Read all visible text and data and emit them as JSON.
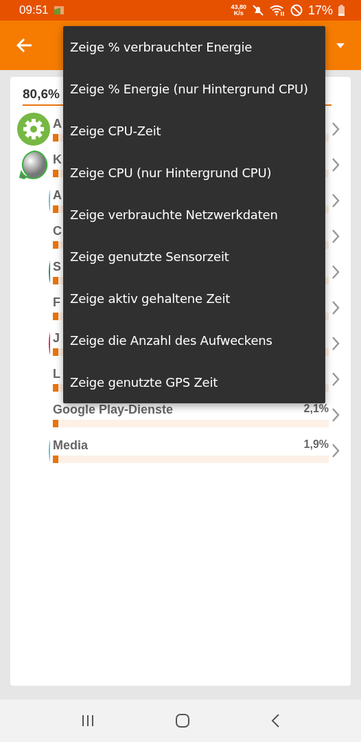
{
  "status_bar": {
    "time": "09:51",
    "net_speed_value": "43,80",
    "net_speed_unit": "K/s",
    "battery": "17%"
  },
  "summary": {
    "total": "80,6%"
  },
  "rows": [
    {
      "name": "A",
      "kind": "settings-app",
      "level": 0.02
    },
    {
      "name": "K",
      "kind": "sphere-app",
      "level": 0.02
    },
    {
      "name": "A",
      "kind": "edge-only",
      "color": "#4fc3e0",
      "level": 0.02
    },
    {
      "name": "C",
      "kind": "blank",
      "level": 0.02
    },
    {
      "name": "S",
      "kind": "edge-only",
      "color": "#1a8a70",
      "level": 0.02
    },
    {
      "name": "F",
      "kind": "blank",
      "level": 0.02
    },
    {
      "name": "J",
      "kind": "edge-only",
      "color": "#e0284f",
      "level": 0.02
    },
    {
      "name": "L",
      "kind": "blank",
      "level": 0.02
    },
    {
      "name": "Google Play-Dienste",
      "percent": "2,1%",
      "kind": "blank",
      "level": 0.02
    },
    {
      "name": "Media",
      "percent": "1,9%",
      "kind": "edge-only",
      "color": "#4fc3e0",
      "level": 0.02
    }
  ],
  "menu": [
    "Zeige % verbrauchter Energie",
    "Zeige % Energie (nur Hintergrund CPU)",
    "Zeige CPU-Zeit",
    "Zeige CPU (nur Hintergrund CPU)",
    "Zeige verbrauchte Netzwerkdaten",
    "Zeige genutzte Sensorzeit",
    "Zeige aktiv gehaltene Zeit",
    "Zeige die Anzahl des Aufweckens",
    "Zeige genutzte GPS Zeit"
  ]
}
